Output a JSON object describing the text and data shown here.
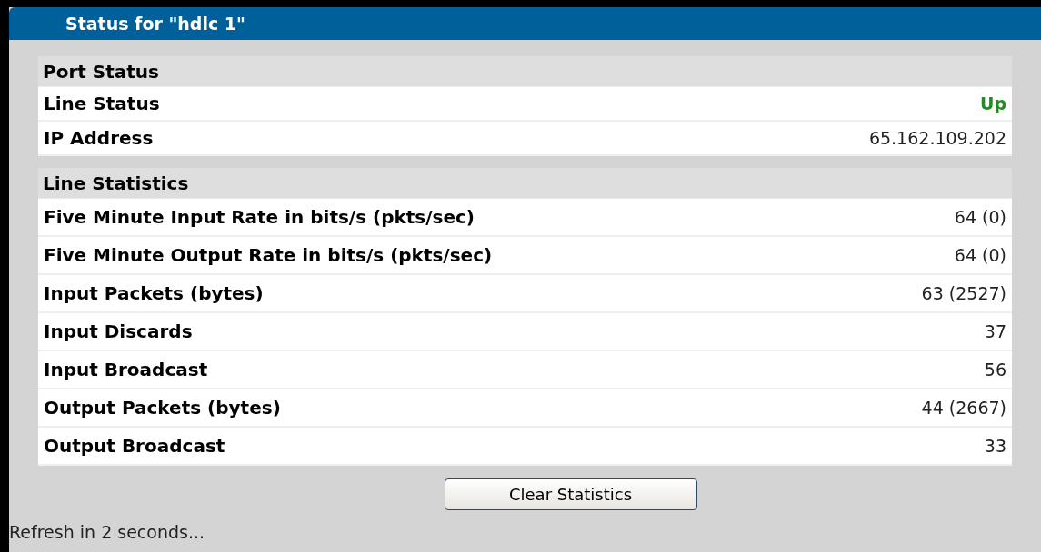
{
  "title": "Status for \"hdlc 1\"",
  "sections": [
    {
      "heading": "Port Status",
      "rows": [
        {
          "label": "Line Status",
          "value": "Up",
          "color": "#228b22"
        },
        {
          "label": "IP Address",
          "value": "65.162.109.202"
        }
      ]
    },
    {
      "heading": "Line Statistics",
      "rows": [
        {
          "label": "Five Minute Input Rate in bits/s (pkts/sec)",
          "value": "64 (0)"
        },
        {
          "label": "Five Minute Output Rate in bits/s (pkts/sec)",
          "value": "64 (0)"
        },
        {
          "label": "Input Packets (bytes)",
          "value": "63 (2527)"
        },
        {
          "label": "Input Discards",
          "value": "37"
        },
        {
          "label": "Input Broadcast",
          "value": "56"
        },
        {
          "label": "Output Packets (bytes)",
          "value": "44 (2667)"
        },
        {
          "label": "Output Broadcast",
          "value": "33"
        }
      ]
    }
  ],
  "button": "Clear Statistics",
  "footer": "Refresh in 2 seconds..."
}
